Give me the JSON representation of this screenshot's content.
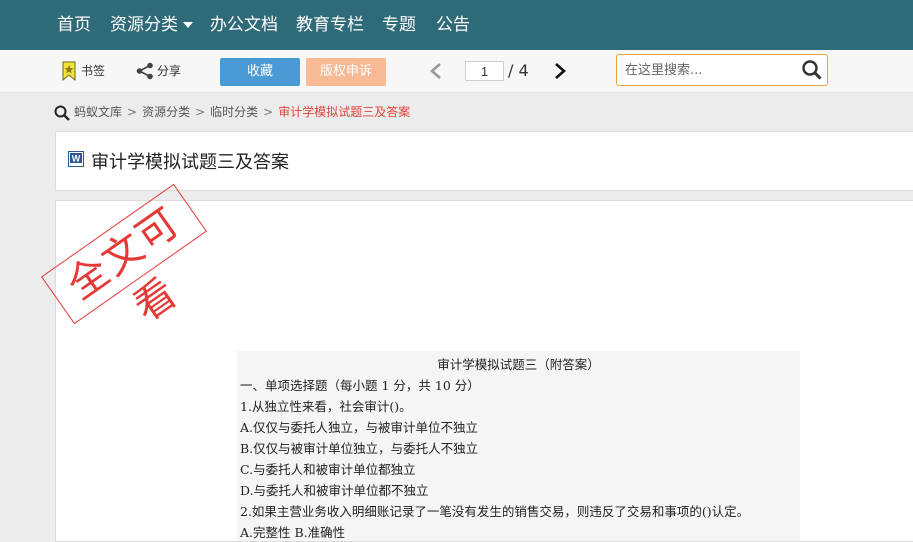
{
  "nav": {
    "items": [
      "首页",
      "资源分类",
      "办公文档",
      "教育专栏",
      "专题",
      "公告"
    ]
  },
  "toolbar": {
    "bookmark_label": "书签",
    "share_label": "分享",
    "favorite_label": "收藏",
    "copyright_label": "版权申诉",
    "page_current": "1",
    "page_total": "/ 4",
    "search_placeholder": "在这里搜索..."
  },
  "breadcrumb": {
    "items": [
      "蚂蚁文库",
      "资源分类",
      "临时分类"
    ],
    "separator": ">",
    "current": "审计学模拟试题三及答案"
  },
  "document": {
    "title": "审计学模拟试题三及答案",
    "file_type_icon": "word-doc-icon",
    "stamp_text": "全文可看",
    "lines": [
      "审计学模拟试题三（附答案）",
      "一、单项选择题（每小题 1 分，共 10 分）",
      " 1.从独立性来看，社会审计()。",
      "A.仅仅与委托人独立，与被审计单位不独立",
      "B.仅仅与被审计单位独立，与委托人不独立",
      "C.与委托人和被审计单位都独立",
      "D.与委托人和被审计单位都不独立",
      "2.如果主营业务收入明细账记录了一笔没有发生的销售交易，则违反了交易和事项的()认定。",
      "A.完整性 B.准确性"
    ]
  },
  "colors": {
    "nav_bg": "#2f6a78",
    "favorite_bg": "#4a9ad6",
    "copyright_bg": "#f8b994",
    "search_border": "#e8a43a",
    "breadcrumb_current": "#e0433a",
    "stamp": "#e53935"
  }
}
